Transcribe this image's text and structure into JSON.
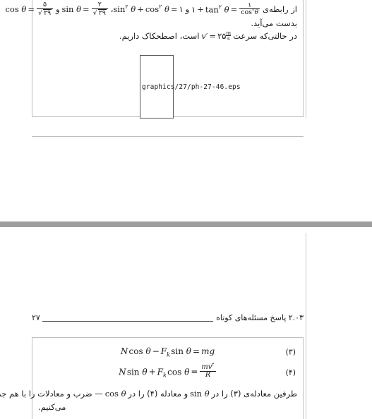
{
  "document": {
    "type": "latex-dvi-preview",
    "language": "fa",
    "page_background": "#ffffff",
    "band_color": "#9e9e9e",
    "frame_border_color": "#c0c0c0"
  },
  "page_top": {
    "paragraph": {
      "line1": {
        "text_rtl_lead": "از رابطه‌ی",
        "math_1": "1 + tan² θ = 1 / cos² θ",
        "conjunction": "و",
        "math_2": "sin² θ + cos² θ = 1",
        "comma": "،",
        "math_3": "sin θ = 2 / √29",
        "conjunction2": "و",
        "math_4": "cos θ = 5 / √29",
        "numerals": {
          "one": "۱",
          "two": "۲",
          "five": "۵",
          "twentynine": "۲۹"
        }
      },
      "line2": "بدست می‌آید.",
      "line3": {
        "prefix": "در حالتی‌که سرعت",
        "math": "v′ = ۲۵ m/s",
        "value": "۲۵",
        "unit_num": "m",
        "unit_den": "s",
        "suffix": "است، اصطحکاک داریم."
      }
    },
    "graphic_placeholder": {
      "path": "graphics/27/ph-27-46.eps",
      "border_color": "#555555"
    }
  },
  "page_bottom": {
    "running_head": {
      "section_number": "۲.۰۳",
      "section_title": "پاسخ مسئله‌های کوتاه",
      "page_number": "۲۷"
    },
    "equations": [
      {
        "tag": "(۳)",
        "lhs": "N cos θ − F_k sin θ",
        "rhs": "mg",
        "parts": {
          "N": "N",
          "cos": "cos",
          "theta": "θ",
          "minus": "−",
          "F": "F",
          "k": "k",
          "sin": "sin",
          "equals": "=",
          "m": "m",
          "g": "g"
        }
      },
      {
        "tag": "(۴)",
        "lhs": "N sin θ + F_k cos θ",
        "rhs": "mv² / R",
        "parts": {
          "N": "N",
          "sin": "sin",
          "theta": "θ",
          "plus": "+",
          "F": "F",
          "k": "k",
          "cos": "cos",
          "equals": "=",
          "num_m": "m",
          "num_v": "v",
          "num_exp": "۲",
          "den_R": "R"
        }
      }
    ],
    "closing_text": {
      "line1_a": "طرفین معادله‌ی (۳) را در",
      "line1_math1": "sin θ",
      "line1_b": "و معادله (۴) را در",
      "line1_math2": "cos θ",
      "line1_c": "— ضرب و معادلات را با هم جمع",
      "line2": "می‌کنیم."
    }
  }
}
